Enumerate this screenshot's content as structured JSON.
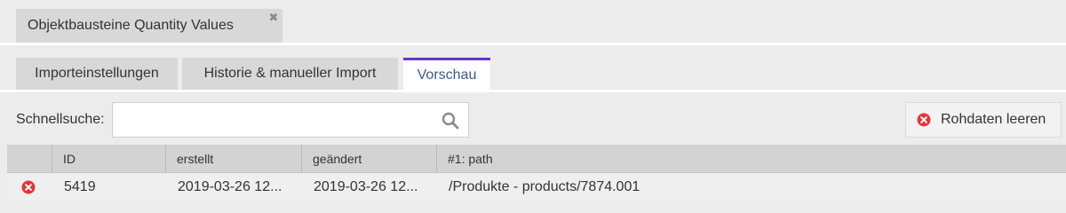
{
  "doc_tab": {
    "title": "Objektbausteine Quantity Values",
    "close_icon": "close-icon"
  },
  "sub_tabs": [
    {
      "label": "Importeinstellungen",
      "active": false
    },
    {
      "label": "Historie & manueller Import",
      "active": false
    },
    {
      "label": "Vorschau",
      "active": true
    }
  ],
  "toolbar": {
    "search_label": "Schnellsuche:",
    "search_value": "",
    "search_placeholder": "",
    "clear_button_label": "Rohdaten leeren"
  },
  "grid": {
    "columns": [
      "",
      "ID",
      "erstellt",
      "geändert",
      "#1: path"
    ],
    "rows": [
      {
        "id": "5419",
        "created": "2019-03-26 12...",
        "modified": "2019-03-26 12...",
        "path": "/Produkte - products/7874.001"
      }
    ]
  },
  "colors": {
    "accent": "#6a33c8",
    "delete": "#e0373a",
    "active_tab_text": "#3d5a8a"
  }
}
